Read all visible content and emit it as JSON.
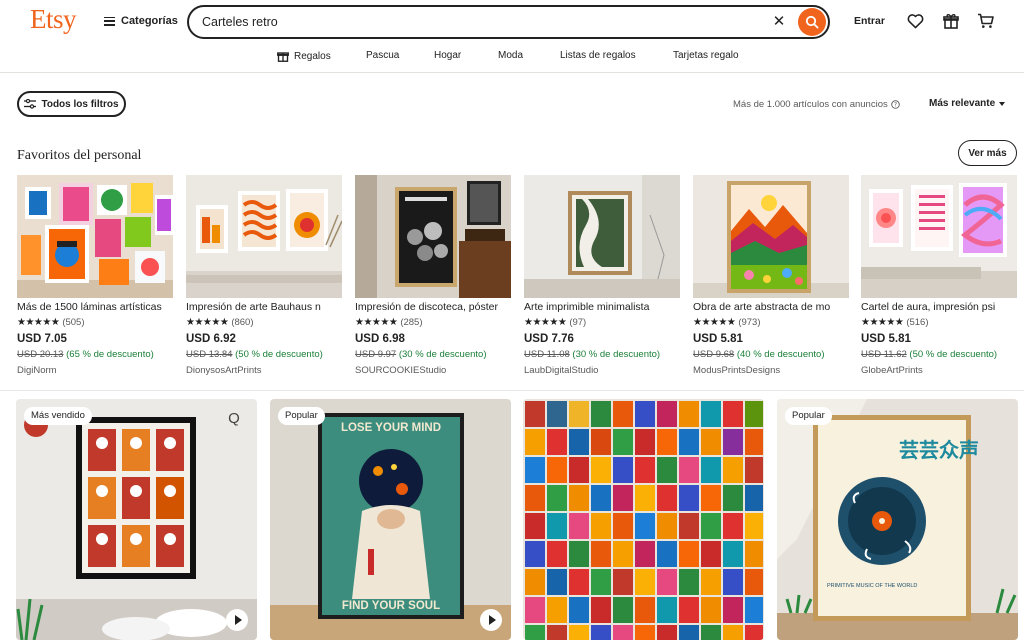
{
  "header": {
    "logo": "Etsy",
    "categories_label": "Categorías",
    "search_value": "Carteles retro",
    "signin_label": "Entrar"
  },
  "nav": {
    "items": [
      "Regalos",
      "Pascua",
      "Hogar",
      "Moda",
      "Listas de regalos",
      "Tarjetas regalo"
    ]
  },
  "filters": {
    "all_filters_label": "Todos los filtros",
    "results_text": "Más de 1.000 artículos con anuncios",
    "sort_label": "Más relevante"
  },
  "staff_picks": {
    "title": "Favoritos del personal",
    "see_more_label": "Ver más",
    "items": [
      {
        "title": "Más de 1500 láminas artísticas",
        "stars": "★★★★★",
        "reviews": "(505)",
        "price": "USD 7.05",
        "original": "USD 20.13",
        "discount": "(65 % de descuento)",
        "shop": "DigiNorm"
      },
      {
        "title": "Impresión de arte Bauhaus n",
        "stars": "★★★★★",
        "reviews": "(860)",
        "price": "USD 6.92",
        "original": "USD 13.84",
        "discount": "(50 % de descuento)",
        "shop": "DionysosArtPrints"
      },
      {
        "title": "Impresión de discoteca, póster",
        "stars": "★★★★★",
        "reviews": "(285)",
        "price": "USD 6.98",
        "original": "USD 9.97",
        "discount": "(30 % de descuento)",
        "shop": "SOURCOOKIEStudio"
      },
      {
        "title": "Arte imprimible minimalista",
        "stars": "★★★★★",
        "reviews": "(97)",
        "price": "USD 7.76",
        "original": "USD 11.08",
        "discount": "(30 % de descuento)",
        "shop": "LaubDigitalStudio"
      },
      {
        "title": "Obra de arte abstracta de mo",
        "stars": "★★★★★",
        "reviews": "(973)",
        "price": "USD 5.81",
        "original": "USD 9.68",
        "discount": "(40 % de descuento)",
        "shop": "ModusPrintsDesigns"
      },
      {
        "title": "Cartel de aura, impresión psi",
        "stars": "★★★★★",
        "reviews": "(516)",
        "price": "USD 5.81",
        "original": "USD 11.62",
        "discount": "(50 % de descuento)",
        "shop": "GlobeArtPrints"
      }
    ]
  },
  "listings": {
    "badges": [
      "Más vendido",
      "Popular",
      "Popular"
    ],
    "poster2_top": "LOSE YOUR MIND",
    "poster2_bottom": "FIND YOUR SOUL",
    "poster4_title": "芸芸众声",
    "poster4_caption": "PRIMITIVE MUSIC OF THE WORLD",
    "poster1_brand": "Q"
  },
  "colors": {
    "brand": "#f1641e",
    "discount_green": "#1a7f37"
  },
  "icons": [
    "hamburger-icon",
    "close-icon",
    "search-icon",
    "heart-icon",
    "gift-icon",
    "cart-icon",
    "filter-icon",
    "info-icon",
    "play-icon"
  ]
}
